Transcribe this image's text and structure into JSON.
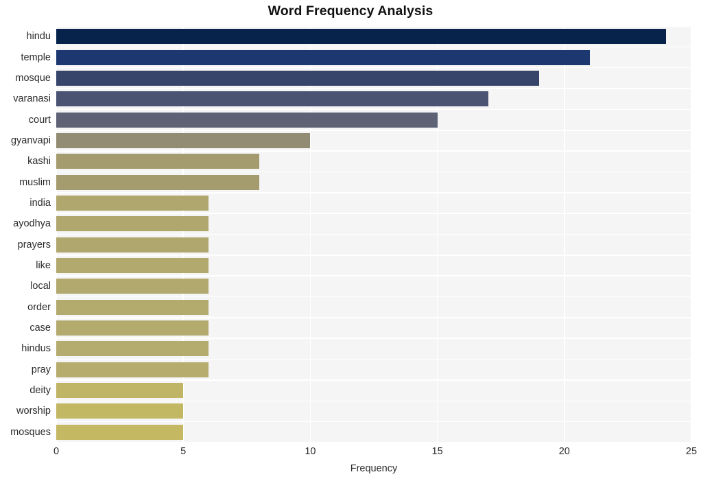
{
  "chart_data": {
    "type": "bar",
    "orientation": "horizontal",
    "title": "Word Frequency Analysis",
    "xlabel": "Frequency",
    "ylabel": "",
    "categories": [
      "hindu",
      "temple",
      "mosque",
      "varanasi",
      "court",
      "gyanvapi",
      "kashi",
      "muslim",
      "india",
      "ayodhya",
      "prayers",
      "like",
      "local",
      "order",
      "case",
      "hindus",
      "pray",
      "deity",
      "worship",
      "mosques"
    ],
    "values": [
      24,
      21,
      19,
      17,
      15,
      10,
      8,
      8,
      6,
      6,
      6,
      6,
      6,
      6,
      6,
      6,
      6,
      5,
      5,
      5
    ],
    "bar_colors": [
      "#07234c",
      "#1d3871",
      "#38456b",
      "#4b5372",
      "#5d6275",
      "#938c74",
      "#a49c6f",
      "#a49c6f",
      "#b0a76e",
      "#b0a76e",
      "#b0a76e",
      "#b2a96e",
      "#b2a96e",
      "#b3aa6e",
      "#b3aa6e",
      "#b4ab6e",
      "#b5ac6e",
      "#c0b566",
      "#c2b763",
      "#c4b862"
    ],
    "xlim": [
      0,
      25
    ],
    "xticks": [
      0,
      5,
      10,
      15,
      20,
      25
    ],
    "xtick_labels": [
      "0",
      "5",
      "10",
      "15",
      "20",
      "25"
    ],
    "grid": true,
    "grid_color": "#ffffff",
    "plot_background": "#f5f5f5",
    "figure_background": "#ffffff",
    "legend": null
  }
}
